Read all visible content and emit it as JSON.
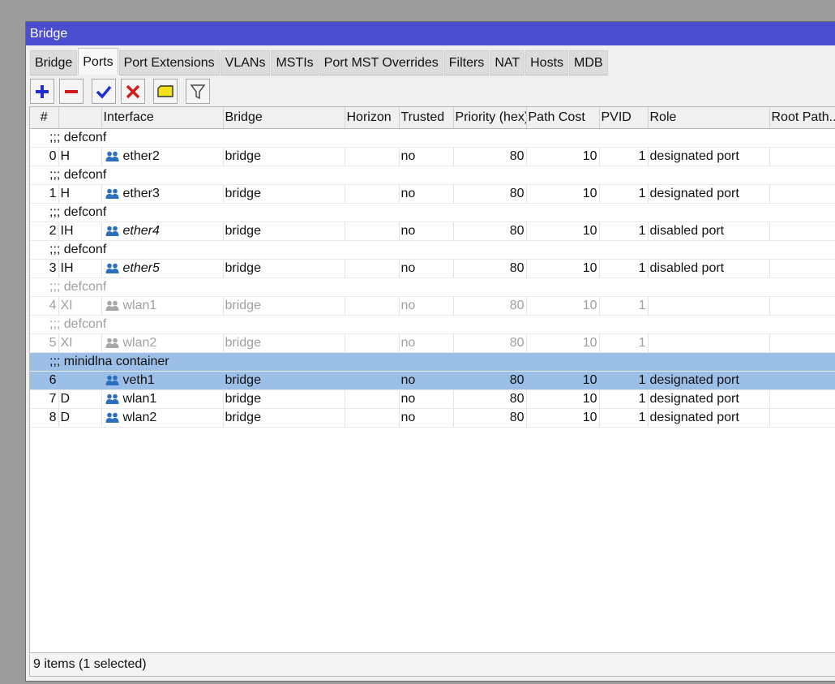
{
  "window": {
    "title": "Bridge"
  },
  "tabs": [
    {
      "label": "Bridge",
      "active": false
    },
    {
      "label": "Ports",
      "active": true
    },
    {
      "label": "Port Extensions",
      "active": false
    },
    {
      "label": "VLANs",
      "active": false
    },
    {
      "label": "MSTIs",
      "active": false
    },
    {
      "label": "Port MST Overrides",
      "active": false
    },
    {
      "label": "Filters",
      "active": false
    },
    {
      "label": "NAT",
      "active": false
    },
    {
      "label": "Hosts",
      "active": false
    },
    {
      "label": "MDB",
      "active": false
    }
  ],
  "toolbar": {
    "buttons": [
      {
        "name": "add-button",
        "icon": "plus-icon",
        "color": "#1c2fd6"
      },
      {
        "name": "remove-button",
        "icon": "minus-icon",
        "color": "#d01c1c"
      },
      {
        "name": "enable-button",
        "icon": "check-icon",
        "color": "#1c2fd6"
      },
      {
        "name": "disable-button",
        "icon": "cross-icon",
        "color": "#d01c1c"
      },
      {
        "name": "comment-button",
        "icon": "note-icon",
        "color": "#f2e01a"
      },
      {
        "name": "filter-button",
        "icon": "filter-icon",
        "color": "#4a4a4a"
      }
    ]
  },
  "table": {
    "columns": [
      "#",
      "",
      "Interface",
      "Bridge",
      "Horizon",
      "Trusted",
      "Priority (hex)",
      "Path Cost",
      "PVID",
      "Role",
      "Root Path..."
    ],
    "rows": [
      {
        "kind": "comment",
        "text": ";;; defconf",
        "disabled": false
      },
      {
        "kind": "data",
        "num": "0",
        "flags": "H",
        "interface": "ether2",
        "italic": false,
        "bridge": "bridge",
        "horizon": "",
        "trusted": "no",
        "priority": "80",
        "path_cost": "10",
        "pvid": "1",
        "role": "designated port",
        "disabled": false
      },
      {
        "kind": "comment",
        "text": ";;; defconf",
        "disabled": false
      },
      {
        "kind": "data",
        "num": "1",
        "flags": "H",
        "interface": "ether3",
        "italic": false,
        "bridge": "bridge",
        "horizon": "",
        "trusted": "no",
        "priority": "80",
        "path_cost": "10",
        "pvid": "1",
        "role": "designated port",
        "disabled": false
      },
      {
        "kind": "comment",
        "text": ";;; defconf",
        "disabled": false
      },
      {
        "kind": "data",
        "num": "2",
        "flags": "IH",
        "interface": "ether4",
        "italic": true,
        "bridge": "bridge",
        "horizon": "",
        "trusted": "no",
        "priority": "80",
        "path_cost": "10",
        "pvid": "1",
        "role": "disabled port",
        "disabled": false
      },
      {
        "kind": "comment",
        "text": ";;; defconf",
        "disabled": false
      },
      {
        "kind": "data",
        "num": "3",
        "flags": "IH",
        "interface": "ether5",
        "italic": true,
        "bridge": "bridge",
        "horizon": "",
        "trusted": "no",
        "priority": "80",
        "path_cost": "10",
        "pvid": "1",
        "role": "disabled port",
        "disabled": false
      },
      {
        "kind": "comment",
        "text": ";;; defconf",
        "disabled": true
      },
      {
        "kind": "data",
        "num": "4",
        "flags": "XI",
        "interface": "wlan1",
        "italic": false,
        "bridge": "bridge",
        "horizon": "",
        "trusted": "no",
        "priority": "80",
        "path_cost": "10",
        "pvid": "1",
        "role": "",
        "disabled": true
      },
      {
        "kind": "comment",
        "text": ";;; defconf",
        "disabled": true
      },
      {
        "kind": "data",
        "num": "5",
        "flags": "XI",
        "interface": "wlan2",
        "italic": false,
        "bridge": "bridge",
        "horizon": "",
        "trusted": "no",
        "priority": "80",
        "path_cost": "10",
        "pvid": "1",
        "role": "",
        "disabled": true
      },
      {
        "kind": "comment",
        "text": ";;; minidlna container",
        "disabled": false,
        "selected": true
      },
      {
        "kind": "data",
        "num": "6",
        "flags": "",
        "interface": "veth1",
        "italic": false,
        "bridge": "bridge",
        "horizon": "",
        "trusted": "no",
        "priority": "80",
        "path_cost": "10",
        "pvid": "1",
        "role": "designated port",
        "disabled": false,
        "selected": true
      },
      {
        "kind": "data",
        "num": "7",
        "flags": "D",
        "interface": "wlan1",
        "italic": false,
        "bridge": "bridge",
        "horizon": "",
        "trusted": "no",
        "priority": "80",
        "path_cost": "10",
        "pvid": "1",
        "role": "designated port",
        "disabled": false
      },
      {
        "kind": "data",
        "num": "8",
        "flags": "D",
        "interface": "wlan2",
        "italic": false,
        "bridge": "bridge",
        "horizon": "",
        "trusted": "no",
        "priority": "80",
        "path_cost": "10",
        "pvid": "1",
        "role": "designated port",
        "disabled": false
      }
    ]
  },
  "status": {
    "text": "9 items (1 selected)"
  },
  "colors": {
    "titlebar": "#4b4fcf",
    "selection": "#9cbfe8",
    "interface_icon_active": "#2a6fc0",
    "interface_icon_disabled": "#a8a8a8"
  }
}
